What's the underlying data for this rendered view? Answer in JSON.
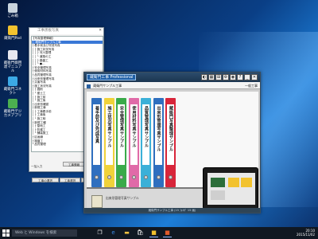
{
  "desktop": {
    "icons": [
      {
        "label": "ごみ箱",
        "color": "#c9d4de"
      },
      {
        "label": "蔵衛門Pad",
        "color": "#f2c22e"
      },
      {
        "label": "蔵衛門御用達マニュアル",
        "color": "#e8e8f0"
      },
      {
        "label": "蔵衛門コネクト",
        "color": "#3ca9e6"
      },
      {
        "label": "蔵衛門デジカメアプリ",
        "color": "#4caf50"
      }
    ]
  },
  "tree_window": {
    "title": "工事黒板写真",
    "rows": [
      "【写真整理情報】",
      "□ 蔵衛門サンプル工事",
      "   ├ 着手前及び完成写真",
      "   │ ├ 施工状況写真",
      "   │ │ ├ 河川整理",
      "   │ │ └ 道路の工",
      "   │ │    ├ 路盤工",
      "   │ │    └ ●…",
      "   ├ 安全管理写真",
      "   ├ 使用材料写真",
      "   ├ 品質管理写真",
      "   ├ 出来形管理写真",
      "   ├ 災害写真",
      "   ├ 施工状況写真",
      "   │ ├ 掘削",
      "   │ └ 盛土工",
      "   │   ├ 施工前",
      "   │   └ 施工後",
      "   ├ 出来形確認",
      "   ├ 新規工事",
      "   │ ├ 工事着手前",
      "   │ ├ 工事後",
      "   │ └ 施工時",
      "   ├ 新規工種",
      "   │ ├ 整地工",
      "   │ ├ 防護工",
      "   │ └ 舗装施工",
      "   ├ 区画線",
      "   ├ 路盤工",
      "   └ 品質管理"
    ],
    "selected_index": 1,
    "buttons": [
      "工事情報",
      "工事追加",
      "工事の選択",
      "工事選択",
      "表示の変更"
    ],
    "footer": "一括入力"
  },
  "app_window": {
    "logo": "蔵衛門工事 Professional",
    "project_label": "蔵衛門サンプル工事",
    "right_label": "一般工事",
    "tools": [
      "◐",
      "▦",
      "⊞",
      "⚙",
      "◉",
      "?",
      "_",
      "✕"
    ],
    "binders": [
      {
        "label": "着手前及び完成写真",
        "color": "#2f6fbf"
      },
      {
        "label": "施工状況写真サンプル",
        "color": "#f0d23a"
      },
      {
        "label": "安全管理写真サンプル",
        "color": "#3aaa4a"
      },
      {
        "label": "使用材料写真サンプル",
        "color": "#e06aa8"
      },
      {
        "label": "品質管理写真サンプル",
        "color": "#3bb0d8"
      },
      {
        "label": "出来形管理写真サンプル",
        "color": "#2f6fbf"
      },
      {
        "label": "蔵衛門写真整理サンプル",
        "color": "#d8253a"
      }
    ],
    "book_label": "出来形管理写真サンプル",
    "status": "蔵衛門サンプル工事 (15 ﾌｫﾙﾀﾞ 15 画)"
  },
  "taskbar": {
    "search_placeholder": "Web と Windows を検索",
    "apps": [
      {
        "icon": "task-view-icon",
        "glyph": "❐",
        "color": "#ffffff"
      },
      {
        "icon": "edge-icon",
        "glyph": "e",
        "color": "#3b8be6"
      },
      {
        "icon": "explorer-icon",
        "glyph": "▬",
        "color": "#f0c040"
      },
      {
        "icon": "store-icon",
        "glyph": "🛍",
        "color": "#ffffff"
      },
      {
        "icon": "kuraemon-icon",
        "glyph": "■",
        "color": "#f2c22e"
      },
      {
        "icon": "kuraemon-app-icon",
        "glyph": "■",
        "color": "#e05a2a"
      }
    ],
    "time": "20:10",
    "date": "2015/11/02"
  }
}
